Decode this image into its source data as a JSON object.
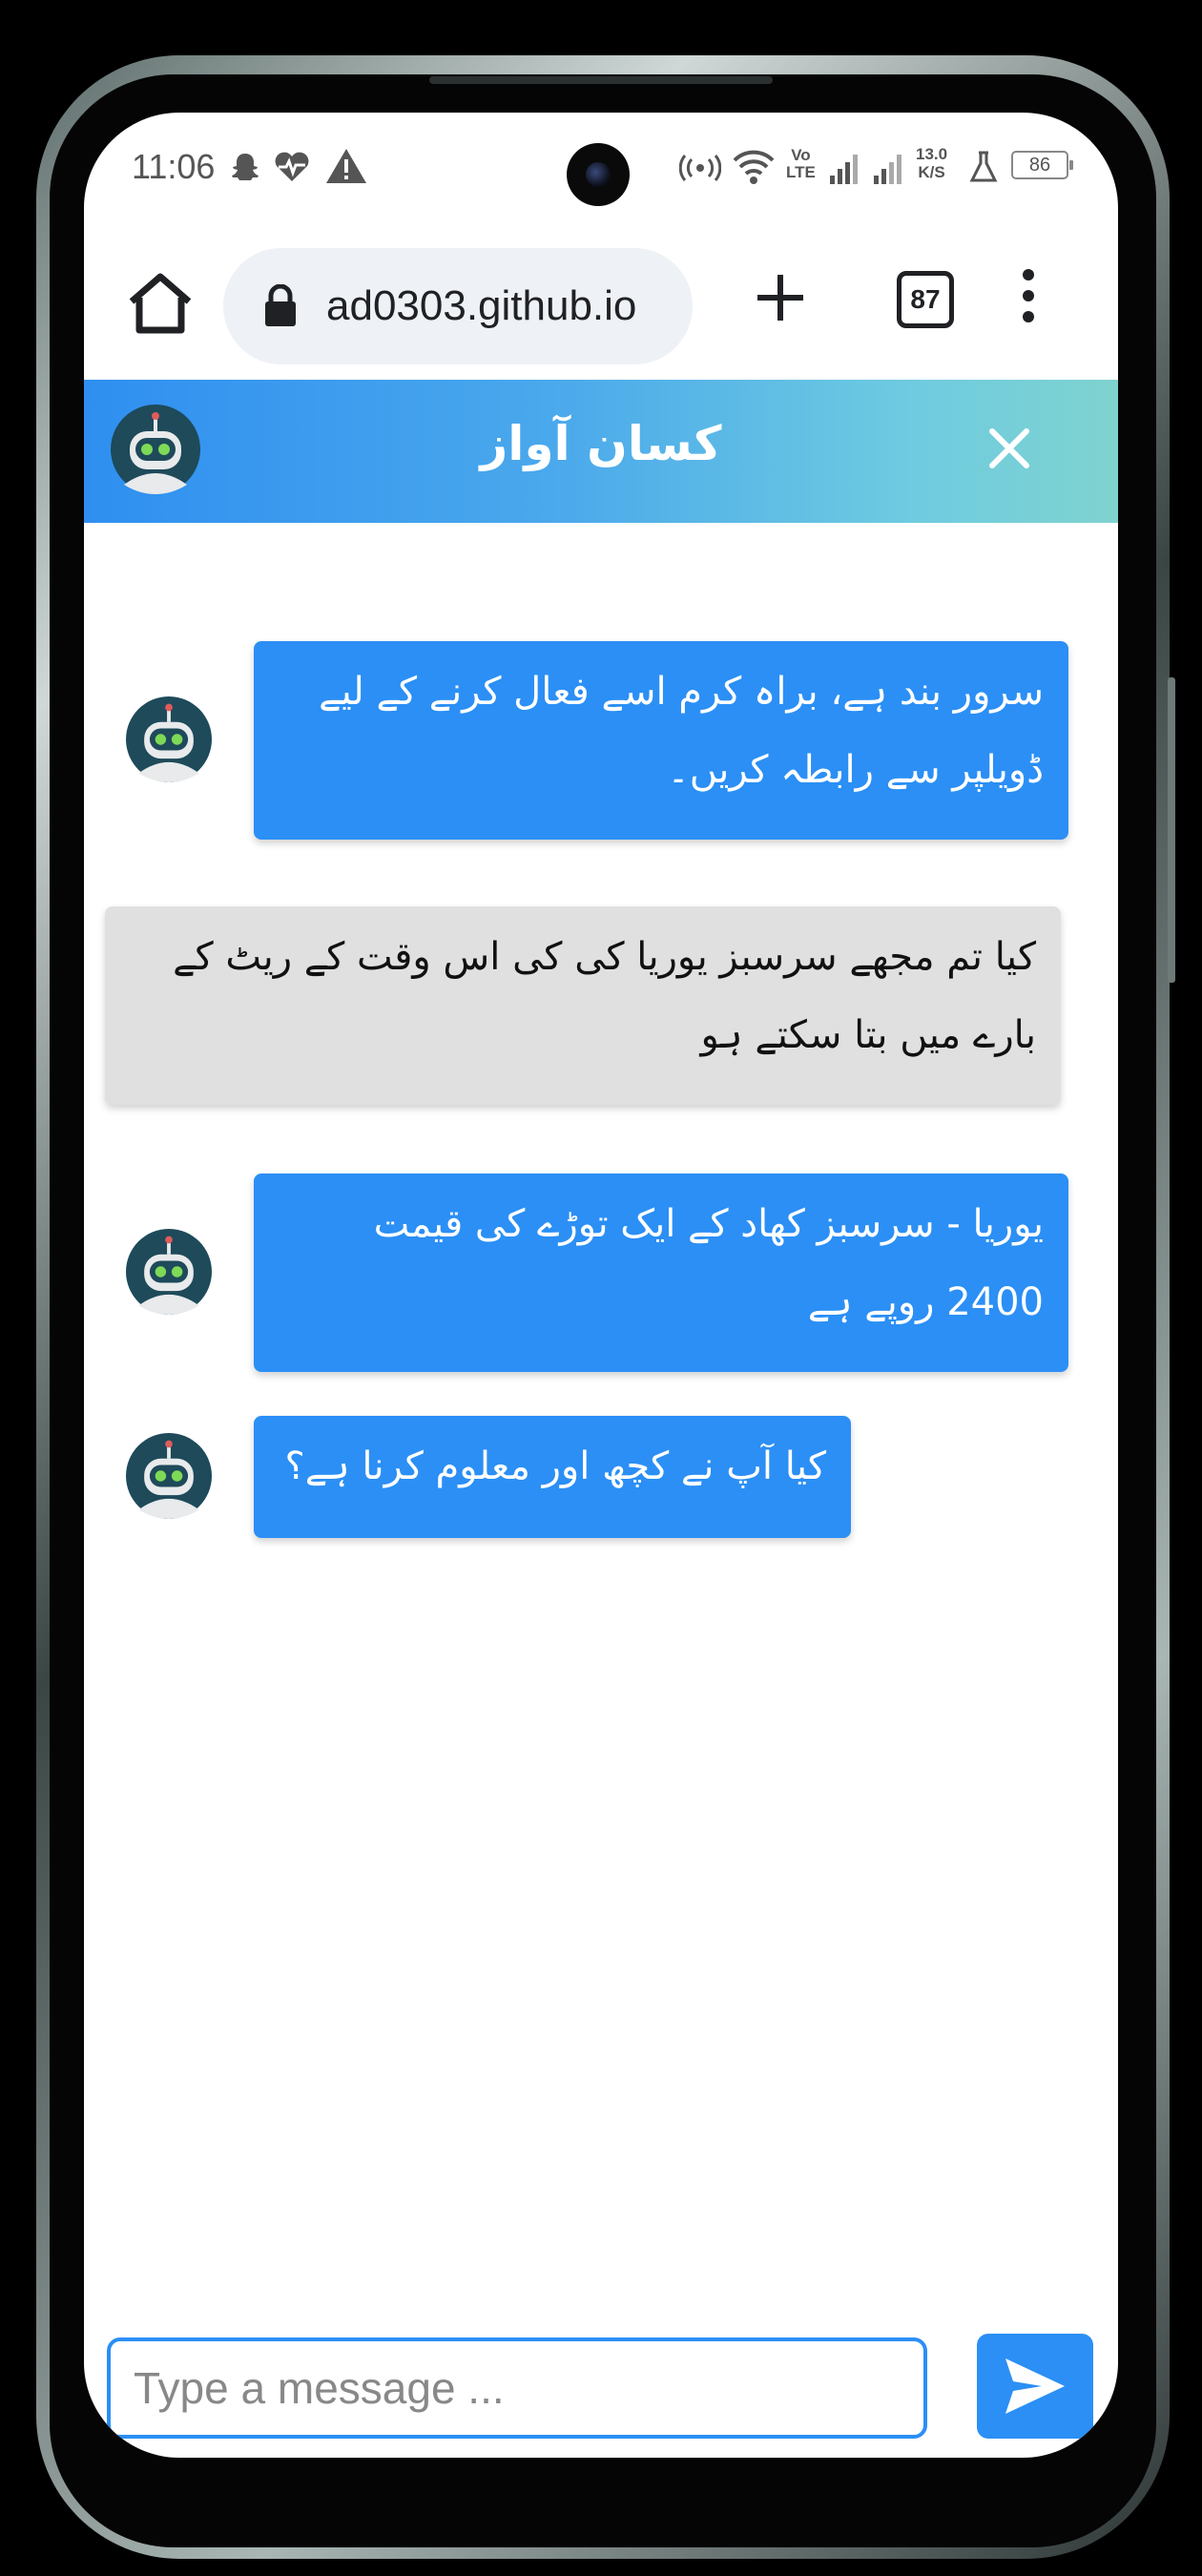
{
  "status_bar": {
    "time": "11:06",
    "icons": [
      "snapchat-icon",
      "heart-pulse-icon",
      "warning-icon",
      "hotspot-icon",
      "wifi-icon",
      "signal-icon",
      "signal-icon",
      "flask-icon"
    ],
    "volte_line1": "Vo",
    "volte_line2": "LTE",
    "net_speed_value": "13.0",
    "net_speed_unit": "K/S",
    "battery": "86"
  },
  "browser": {
    "url": "ad0303.github.io",
    "tab_count": "87"
  },
  "chat": {
    "title": "کسان آواز",
    "messages": [
      {
        "sender": "bot",
        "text": "سرور بند ہے، براہ کرم اسے فعال کرنے کے لیے ڈویلپر سے رابطہ کریں۔"
      },
      {
        "sender": "user",
        "text": "کیا تم مجھے سرسبز یوریا کی کی اس وقت کے ریٹ کے بارے میں بتا سکتے ہو"
      },
      {
        "sender": "bot",
        "text": "یوریا - سرسبز کھاد کے ایک توڑے کی قیمت 2400 روپے ہے"
      },
      {
        "sender": "bot",
        "text": "کیا آپ نے کچھ اور معلوم کرنا ہے؟"
      }
    ],
    "input_placeholder": "Type a message ..."
  },
  "colors": {
    "bot_bubble": "#2b8ff5",
    "user_bubble": "#e0e0e0",
    "header_gradient_start": "#2f8ff0",
    "header_gradient_end": "#7fd3cf"
  }
}
